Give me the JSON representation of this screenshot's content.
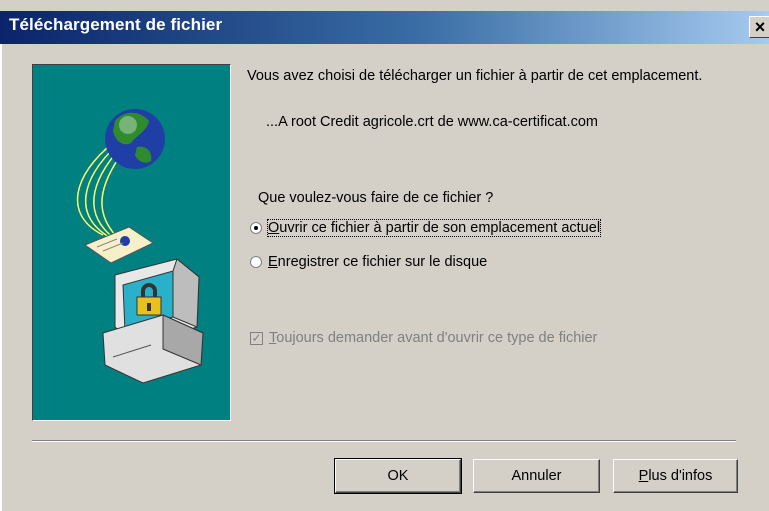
{
  "window": {
    "title": "Téléchargement de fichier",
    "close_label": "×"
  },
  "content": {
    "intro": "Vous avez choisi de télécharger un fichier à partir de cet emplacement.",
    "filename": "...A root Credit agricole.crt de www.ca-certificat.com",
    "question": "Que voulez-vous faire de ce fichier ?"
  },
  "options": {
    "open": {
      "accel": "O",
      "rest": "uvrir ce fichier à partir de son emplacement actuel",
      "selected": true
    },
    "save": {
      "accel": "E",
      "rest": "nregistrer ce fichier sur le disque",
      "selected": false
    }
  },
  "always_ask": {
    "accel": "T",
    "rest": "oujours demander avant d'ouvrir ce type de fichier",
    "checked": true,
    "enabled": false
  },
  "buttons": {
    "ok": "OK",
    "cancel": "Annuler",
    "more_info_accel": "P",
    "more_info_rest": "lus d'infos"
  },
  "icons": {
    "illustration": "globe-network-computer-lock-illustration",
    "close": "close-icon"
  },
  "colors": {
    "title_gradient_start": "#0a246a",
    "title_gradient_end": "#a6caf0",
    "illustration_bg": "#008080",
    "dialog_bg": "#d4d0c8"
  }
}
